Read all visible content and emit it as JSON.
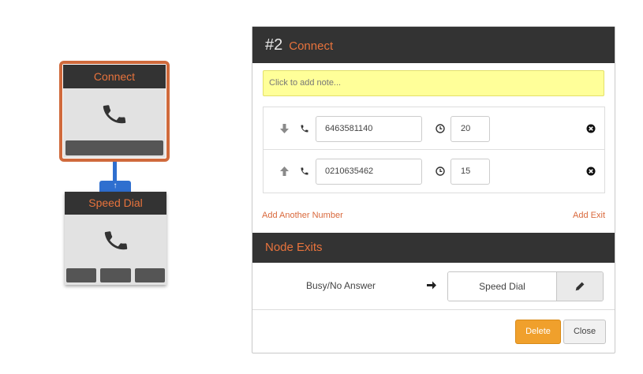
{
  "canvas": {
    "nodes": [
      {
        "title": "Connect",
        "icon": "phone-icon",
        "selected": true
      },
      {
        "title": "Speed Dial",
        "icon": "phone-icon",
        "exit_count": 3
      }
    ],
    "connector_glyph": "↑"
  },
  "panel": {
    "number": "#2",
    "title": "Connect",
    "note_placeholder": "Click to add note...",
    "numbers": [
      {
        "order_icon": "arrow-down-icon",
        "phone": "6463581140",
        "timeout": "20"
      },
      {
        "order_icon": "arrow-up-icon",
        "phone": "0210635462",
        "timeout": "15"
      }
    ],
    "add_number_label": "Add Another Number",
    "add_exit_label": "Add Exit",
    "exits_title": "Node Exits",
    "exits": [
      {
        "label": "Busy/No Answer",
        "target": "Speed Dial"
      }
    ],
    "delete_label": "Delete",
    "close_label": "Close"
  },
  "colors": {
    "accent_orange": "#e8733c",
    "header_dark": "#333333",
    "connector_blue": "#2f6fcf",
    "note_yellow": "#ffff99",
    "delete_orange": "#f0a02c"
  }
}
